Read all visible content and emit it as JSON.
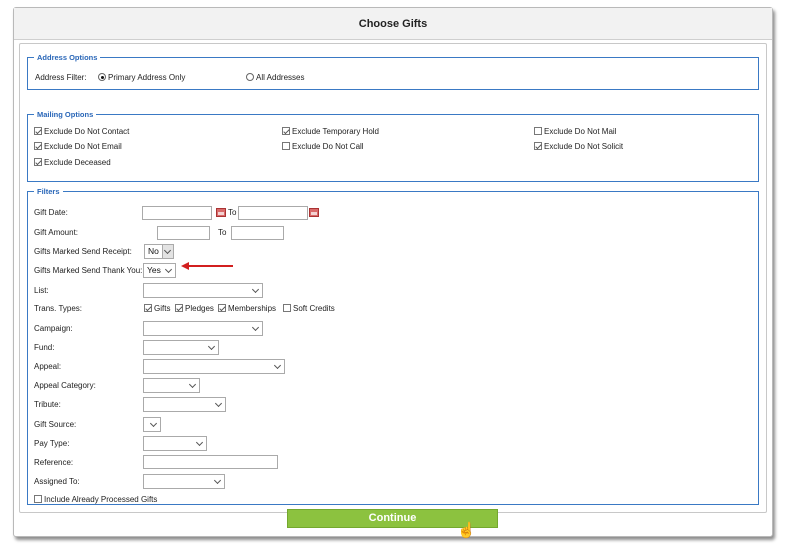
{
  "title": "Choose Gifts",
  "address": {
    "legend": "Address Options",
    "filter_label": "Address Filter:",
    "opt_primary": "Primary Address Only",
    "opt_all": "All Addresses",
    "selected": "Primary Address Only"
  },
  "mailing": {
    "legend": "Mailing Options",
    "items": [
      {
        "label": "Exclude Do Not Contact",
        "checked": true
      },
      {
        "label": "Exclude Temporary Hold",
        "checked": true
      },
      {
        "label": "Exclude Do Not Mail",
        "checked": false
      },
      {
        "label": "Exclude Do Not Email",
        "checked": true
      },
      {
        "label": "Exclude Do Not Call",
        "checked": false
      },
      {
        "label": "Exclude Do Not Solicit",
        "checked": true
      },
      {
        "label": "Exclude Deceased",
        "checked": true
      }
    ]
  },
  "filters": {
    "legend": "Filters",
    "gift_date_label": "Gift Date:",
    "gift_amount_label": "Gift Amount:",
    "to_label": "To",
    "send_receipt_label": "Gifts Marked Send Receipt:",
    "send_receipt_value": "No",
    "send_thankyou_label": "Gifts Marked Send Thank You:",
    "send_thankyou_value": "Yes",
    "list_label": "List:",
    "trans_types_label": "Trans. Types:",
    "trans_types": [
      {
        "label": "Gifts",
        "checked": true
      },
      {
        "label": "Pledges",
        "checked": true
      },
      {
        "label": "Memberships",
        "checked": true
      },
      {
        "label": "Soft Credits",
        "checked": false
      }
    ],
    "campaign_label": "Campaign:",
    "fund_label": "Fund:",
    "appeal_label": "Appeal:",
    "appeal_category_label": "Appeal Category:",
    "tribute_label": "Tribute:",
    "gift_source_label": "Gift Source:",
    "pay_type_label": "Pay Type:",
    "reference_label": "Reference:",
    "assigned_to_label": "Assigned To:",
    "include_processed_label": "Include Already Processed Gifts",
    "include_processed_checked": false
  },
  "continue_label": "Continue",
  "colors": {
    "accent": "#2a67b8",
    "continue": "#8cc23f",
    "arrow": "#d21f1f"
  }
}
